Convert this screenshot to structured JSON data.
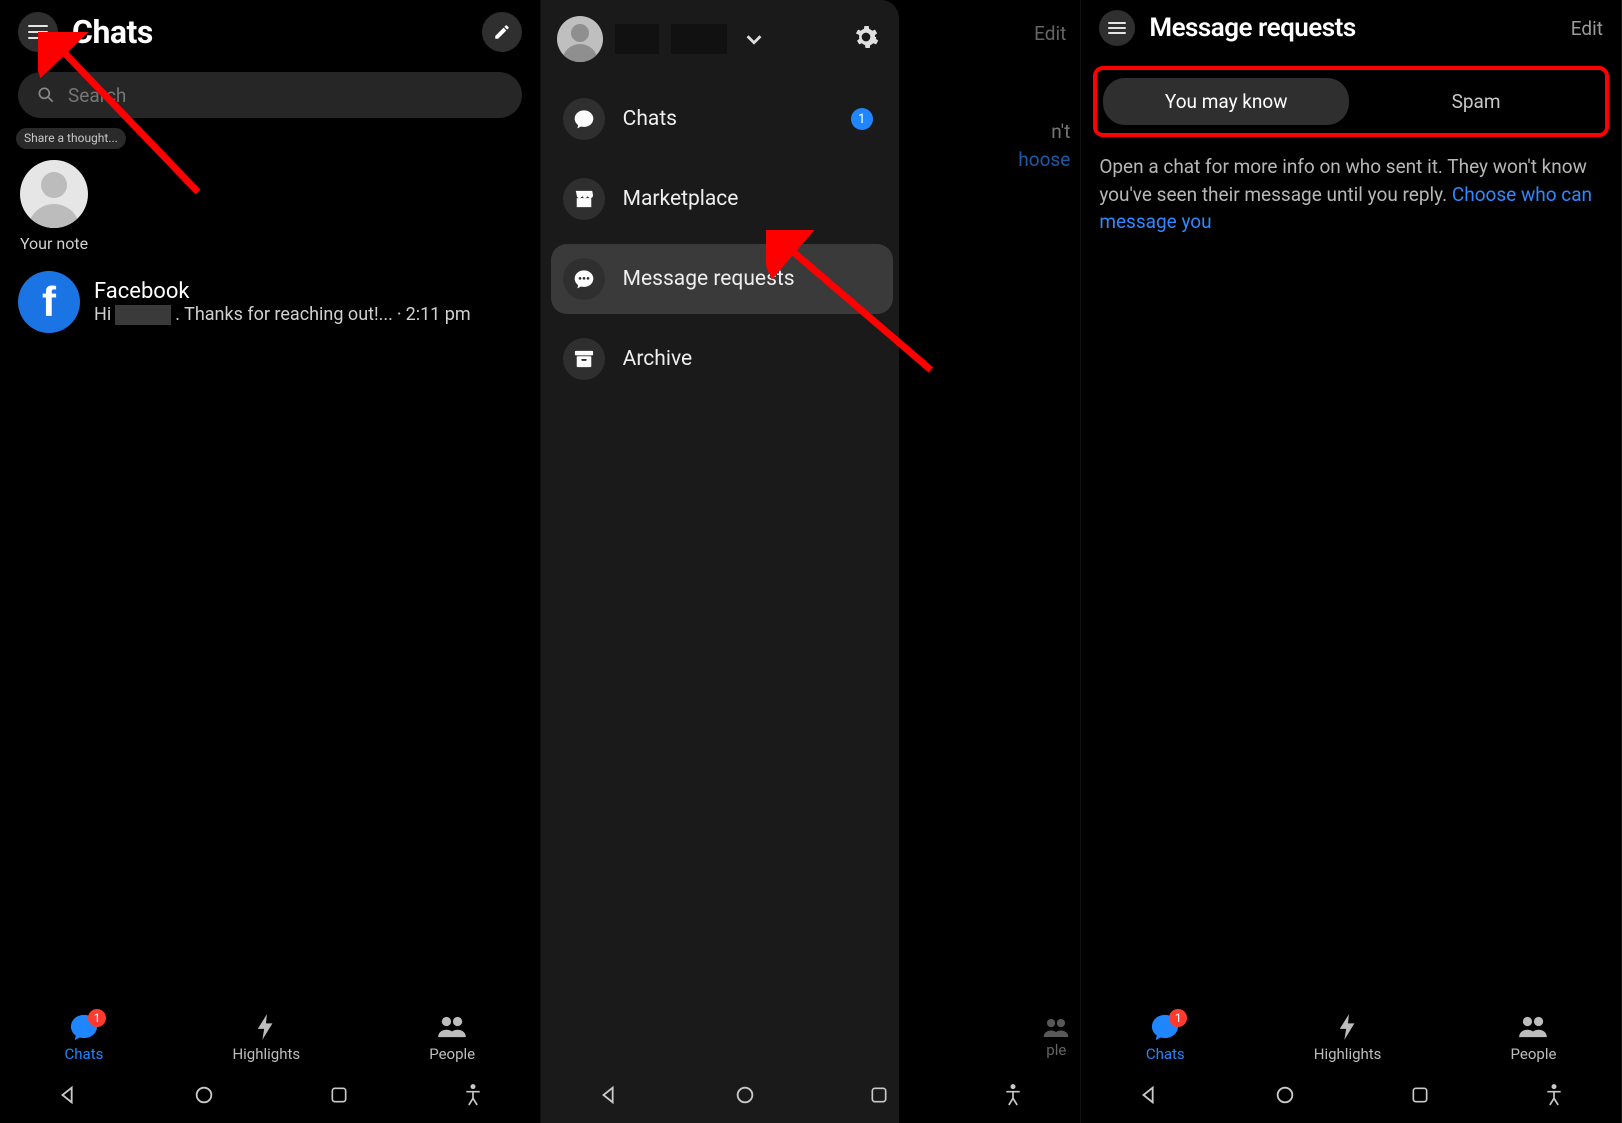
{
  "panel1": {
    "title": "Chats",
    "search_placeholder": "Search",
    "note_bubble": "Share a thought...",
    "note_label": "Your note",
    "chat": {
      "name": "Facebook",
      "preview_prefix": "Hi ",
      "preview_suffix": ". Thanks for reaching out!...",
      "time_sep": " · ",
      "time": "2:11 pm"
    },
    "nav": {
      "chats": "Chats",
      "highlights": "Highlights",
      "people": "People",
      "badge": "1"
    }
  },
  "panel2": {
    "bg_edit": "Edit",
    "bg_line1_tail": "n't",
    "bg_line2_tail": "hoose",
    "bg_people_tail": "ple",
    "drawer": {
      "items": [
        {
          "label": "Chats",
          "badge": "1"
        },
        {
          "label": "Marketplace"
        },
        {
          "label": "Message requests"
        },
        {
          "label": "Archive"
        }
      ]
    }
  },
  "panel3": {
    "title": "Message requests",
    "edit": "Edit",
    "tabs": {
      "youMayKnow": "You may know",
      "spam": "Spam"
    },
    "info_text": "Open a chat for more info on who sent it. They won't know you've seen their message until you reply. ",
    "info_link": "Choose who can message you",
    "nav": {
      "chats": "Chats",
      "highlights": "Highlights",
      "people": "People",
      "badge": "1"
    }
  }
}
